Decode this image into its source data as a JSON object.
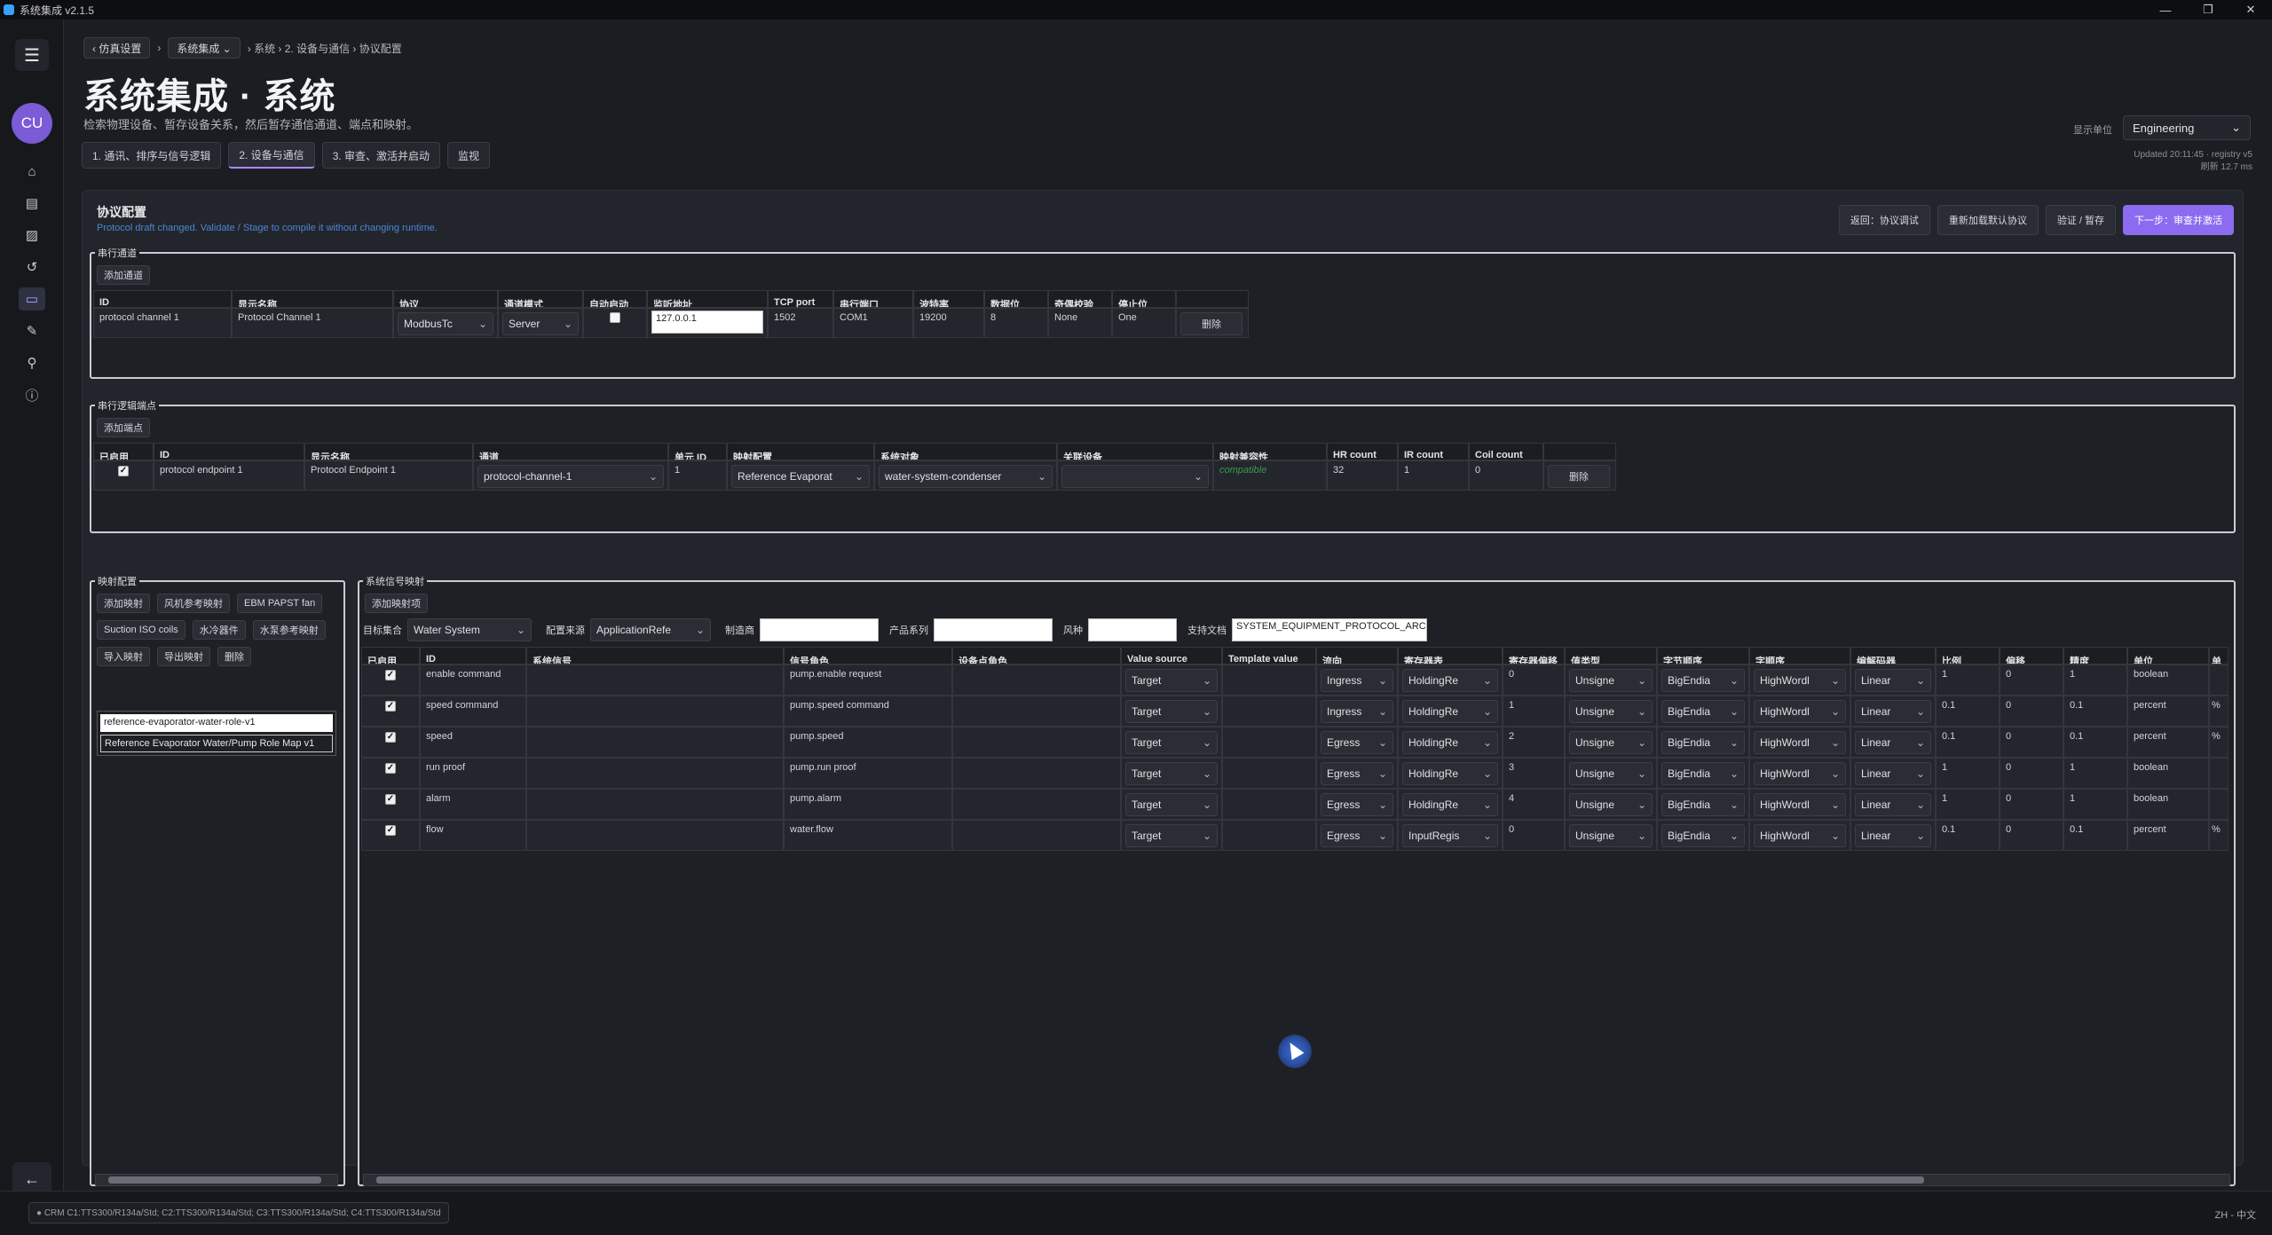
{
  "window": {
    "title": "系统集成 v2.1.5",
    "controls": [
      "—",
      "❐",
      "✕"
    ]
  },
  "sidebar": {
    "menu_icon": "menu-icon",
    "avatar": "CU",
    "icons": [
      "home-icon",
      "document-icon",
      "image-icon",
      "history-icon",
      "device-icon",
      "brush-icon",
      "wrench-icon",
      "info-icon"
    ],
    "back_icon": "arrow-left-icon"
  },
  "breadcrumb": {
    "back": "‹ 仿真设置",
    "project": "系统集成 ⌄",
    "path": "› 系统 › 2. 设备与通信 › 协议配置"
  },
  "page": {
    "title": "系统集成 · 系统",
    "subtitle": "检索物理设备、暂存设备关系，然后暂存通信通道、端点和映射。"
  },
  "steps": [
    {
      "label": "1. 通讯、排序与信号逻辑",
      "active": false
    },
    {
      "label": "2. 设备与通信",
      "active": true
    },
    {
      "label": "3. 审查、激活并启动",
      "active": false
    },
    {
      "label": "监视",
      "active": false
    }
  ],
  "units": {
    "label": "显示单位",
    "value": "Engineering"
  },
  "updated": {
    "line1": "Updated 20:11:45 · registry v5",
    "line2": "刷新 12.7 ms"
  },
  "protocol": {
    "title": "协议配置",
    "note": "Protocol draft changed. Validate / Stage to compile it without changing runtime.",
    "buttons": [
      "返回：协议调试",
      "重新加载默认协议",
      "验证 / 暂存",
      "下一步：审查并激活"
    ]
  },
  "channels": {
    "legend": "串行通道",
    "add": "添加通道",
    "headers": [
      "ID",
      "显示名称",
      "协议",
      "通道模式",
      "自动启动",
      "监听地址",
      "TCP port",
      "串行端口",
      "波特率",
      "数据位",
      "奇偶校验",
      "停止位"
    ],
    "rows": [
      {
        "id": "protocol channel 1",
        "name": "Protocol Channel 1",
        "protocol": "ModbusTc",
        "mode": "Server",
        "autostart": false,
        "address": "127.0.0.1",
        "tcp_port": "1502",
        "serial_port": "COM1",
        "baud": "19200",
        "data_bits": "8",
        "parity": "None",
        "stop_bits": "One",
        "delete": "删除"
      }
    ]
  },
  "endpoints": {
    "legend": "串行逻辑端点",
    "add": "添加端点",
    "headers": [
      "已启用",
      "ID",
      "显示名称",
      "通道",
      "单元 ID",
      "映射配置",
      "系统对象",
      "关联设备",
      "映射兼容性",
      "HR count",
      "IR count",
      "Coil count"
    ],
    "rows": [
      {
        "enabled": true,
        "id": "protocol endpoint 1",
        "name": "Protocol Endpoint 1",
        "channel": "protocol-channel-1",
        "unit_id": "1",
        "profile": "Reference Evaporat",
        "object": "water-system-condenser",
        "device": "",
        "compat": "compatible",
        "hr": "32",
        "ir": "1",
        "coil": "0",
        "delete": "删除"
      }
    ]
  },
  "mapping_config": {
    "legend": "映射配置",
    "buttons": [
      "添加映射",
      "风机参考映射",
      "EBM PAPST fan",
      "Suction ISO coils",
      "水冷器件",
      "水泵参考映射",
      "导入映射",
      "导出映射",
      "删除"
    ],
    "items": [
      "reference-evaporator-water-role-v1",
      "Reference Evaporator Water/Pump Role Map v1"
    ]
  },
  "signal_mapping": {
    "legend": "系统信号映射",
    "add": "添加映射项",
    "filters": {
      "target_label": "目标集合",
      "target": "Water System",
      "source_label": "配置来源",
      "source": "ApplicationRefe",
      "maker_label": "制造商",
      "maker": "",
      "series_label": "产品系列",
      "series": "",
      "model_label": "风种",
      "model": "",
      "doc_label": "支持文档",
      "doc": "SYSTEM_EQUIPMENT_PROTOCOL_ARCH"
    },
    "headers": [
      "已启用",
      "ID",
      "系统信号",
      "信号角色",
      "设备点角色",
      "Value source",
      "Template value",
      "流向",
      "寄存器表",
      "寄存器偏移",
      "值类型",
      "字节顺序",
      "字顺序",
      "编解码器",
      "比例",
      "偏移",
      "精度",
      "单位",
      "单"
    ],
    "rows": [
      {
        "enabled": true,
        "id": "enable command",
        "signal": "",
        "role": "pump.enable request",
        "device_role": "",
        "source": "Target",
        "template": "",
        "dir": "Ingress",
        "table": "HoldingRe",
        "offset": "0",
        "vtype": "Unsigne",
        "byte": "BigEndia",
        "word": "HighWordl",
        "codec": "Linear",
        "scale": "1",
        "shift": "0",
        "prec": "1",
        "unit": "boolean",
        "u2": ""
      },
      {
        "enabled": true,
        "id": "speed command",
        "signal": "",
        "role": "pump.speed command",
        "device_role": "",
        "source": "Target",
        "template": "",
        "dir": "Ingress",
        "table": "HoldingRe",
        "offset": "1",
        "vtype": "Unsigne",
        "byte": "BigEndia",
        "word": "HighWordl",
        "codec": "Linear",
        "scale": "0.1",
        "shift": "0",
        "prec": "0.1",
        "unit": "percent",
        "u2": "%"
      },
      {
        "enabled": true,
        "id": "speed",
        "signal": "",
        "role": "pump.speed",
        "device_role": "",
        "source": "Target",
        "template": "",
        "dir": "Egress",
        "table": "HoldingRe",
        "offset": "2",
        "vtype": "Unsigne",
        "byte": "BigEndia",
        "word": "HighWordl",
        "codec": "Linear",
        "scale": "0.1",
        "shift": "0",
        "prec": "0.1",
        "unit": "percent",
        "u2": "%"
      },
      {
        "enabled": true,
        "id": "run proof",
        "signal": "",
        "role": "pump.run proof",
        "device_role": "",
        "source": "Target",
        "template": "",
        "dir": "Egress",
        "table": "HoldingRe",
        "offset": "3",
        "vtype": "Unsigne",
        "byte": "BigEndia",
        "word": "HighWordl",
        "codec": "Linear",
        "scale": "1",
        "shift": "0",
        "prec": "1",
        "unit": "boolean",
        "u2": ""
      },
      {
        "enabled": true,
        "id": "alarm",
        "signal": "",
        "role": "pump.alarm",
        "device_role": "",
        "source": "Target",
        "template": "",
        "dir": "Egress",
        "table": "HoldingRe",
        "offset": "4",
        "vtype": "Unsigne",
        "byte": "BigEndia",
        "word": "HighWordl",
        "codec": "Linear",
        "scale": "1",
        "shift": "0",
        "prec": "1",
        "unit": "boolean",
        "u2": ""
      },
      {
        "enabled": true,
        "id": "flow",
        "signal": "",
        "role": "water.flow",
        "device_role": "",
        "source": "Target",
        "template": "",
        "dir": "Egress",
        "table": "InputRegis",
        "offset": "0",
        "vtype": "Unsigne",
        "byte": "BigEndia",
        "word": "HighWordl",
        "codec": "Linear",
        "scale": "0.1",
        "shift": "0",
        "prec": "0.1",
        "unit": "percent",
        "u2": "%"
      }
    ]
  },
  "status": {
    "text": "● CRM C1:TTS300/R134a/Std; C2:TTS300/R134a/Std; C3:TTS300/R134a/Std; C4:TTS300/R134a/Std",
    "locale": "ZH - 中文"
  }
}
